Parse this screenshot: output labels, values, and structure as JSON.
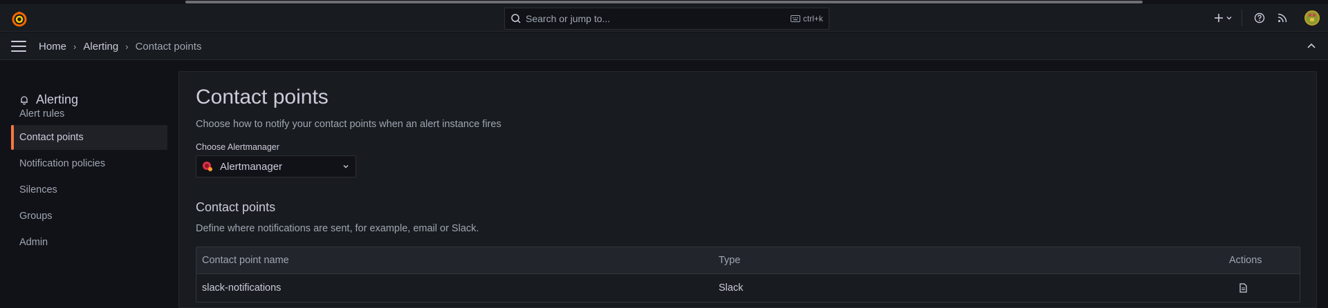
{
  "colors": {
    "accent": "#ff7641",
    "background": "#111217",
    "panel": "#181b1f"
  },
  "topbar": {
    "logo_icon": "grafana-logo",
    "search": {
      "placeholder": "Search or jump to...",
      "shortcut": "ctrl+k",
      "icon": "search-icon",
      "keyboard_icon": "keyboard-icon"
    },
    "add_icon": "plus-icon",
    "help_icon": "help-icon",
    "news_icon": "rss-icon",
    "avatar_icon": "avatar"
  },
  "breadcrumb": {
    "items": [
      "Home",
      "Alerting",
      "Contact points"
    ]
  },
  "sidebar": {
    "section_title": "Alerting",
    "section_icon": "bell-icon",
    "items": [
      {
        "label": "Alert rules",
        "active": false
      },
      {
        "label": "Contact points",
        "active": true
      },
      {
        "label": "Notification policies",
        "active": false
      },
      {
        "label": "Silences",
        "active": false
      },
      {
        "label": "Groups",
        "active": false
      },
      {
        "label": "Admin",
        "active": false
      }
    ]
  },
  "main": {
    "title": "Contact points",
    "description": "Choose how to notify your contact points when an alert instance fires",
    "alertmanager": {
      "label": "Choose Alertmanager",
      "selected": "Alertmanager"
    },
    "contact_points": {
      "title": "Contact points",
      "description": "Define where notifications are sent, for example, email or Slack.",
      "columns": [
        "Contact point name",
        "Type",
        "Actions"
      ],
      "rows": [
        {
          "name": "slack-notifications",
          "type": "Slack",
          "action_icon": "file-icon"
        }
      ]
    }
  }
}
